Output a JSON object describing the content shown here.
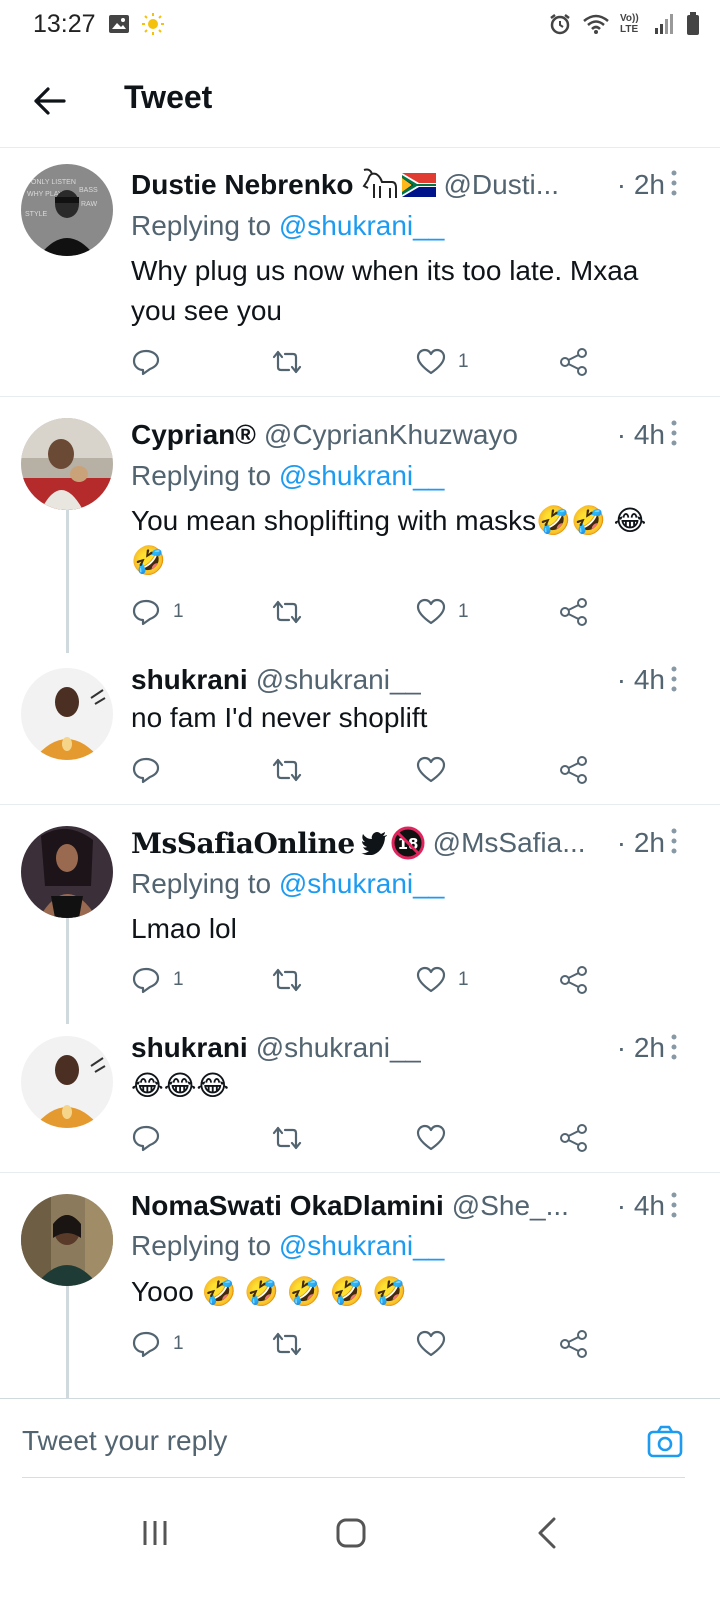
{
  "status_bar": {
    "time": "13:27",
    "network": "Vo)) LTE"
  },
  "header": {
    "title": "Tweet"
  },
  "tweets": [
    {
      "name": "Dustie Nebrenko",
      "handle": "@Dusti...",
      "time": "· 2h",
      "replying_label": "Replying to",
      "replying_to": "@shukrani__",
      "text": "Why plug us now when its too late. Mxaa you see you",
      "reply_count": "",
      "like_count": "1"
    },
    {
      "name": "Cyprian®",
      "handle": "@CyprianKhuzwayo",
      "time": "· 4h",
      "replying_label": "Replying to",
      "replying_to": "@shukrani__",
      "text": "You mean shoplifting with masks🤣🤣 😂🤣",
      "reply_count": "1",
      "like_count": "1"
    },
    {
      "name": "shukrani",
      "handle": "@shukrani__",
      "time": "· 4h",
      "text": "no fam I'd never shoplift",
      "reply_count": "",
      "like_count": ""
    },
    {
      "name": "MsSafiaOnline",
      "handle": "@MsSafia...",
      "time": "· 2h",
      "replying_label": "Replying to",
      "replying_to": "@shukrani__",
      "text": "Lmao lol",
      "reply_count": "1",
      "like_count": "1"
    },
    {
      "name": "shukrani",
      "handle": "@shukrani__",
      "time": "· 2h",
      "text": "😂😂😂",
      "reply_count": "",
      "like_count": ""
    },
    {
      "name": "NomaSwati OkaDlamini",
      "handle": "@She_...",
      "time": "· 4h",
      "replying_label": "Replying to",
      "replying_to": "@shukrani__",
      "text": "Yooo 🤣 🤣 🤣 🤣 🤣",
      "reply_count": "1",
      "like_count": ""
    }
  ],
  "reply_bar": {
    "placeholder": "Tweet your reply"
  },
  "colors": {
    "accent": "#1d9bf0",
    "secondary_text": "#536471",
    "divider": "#e6ecf0"
  }
}
